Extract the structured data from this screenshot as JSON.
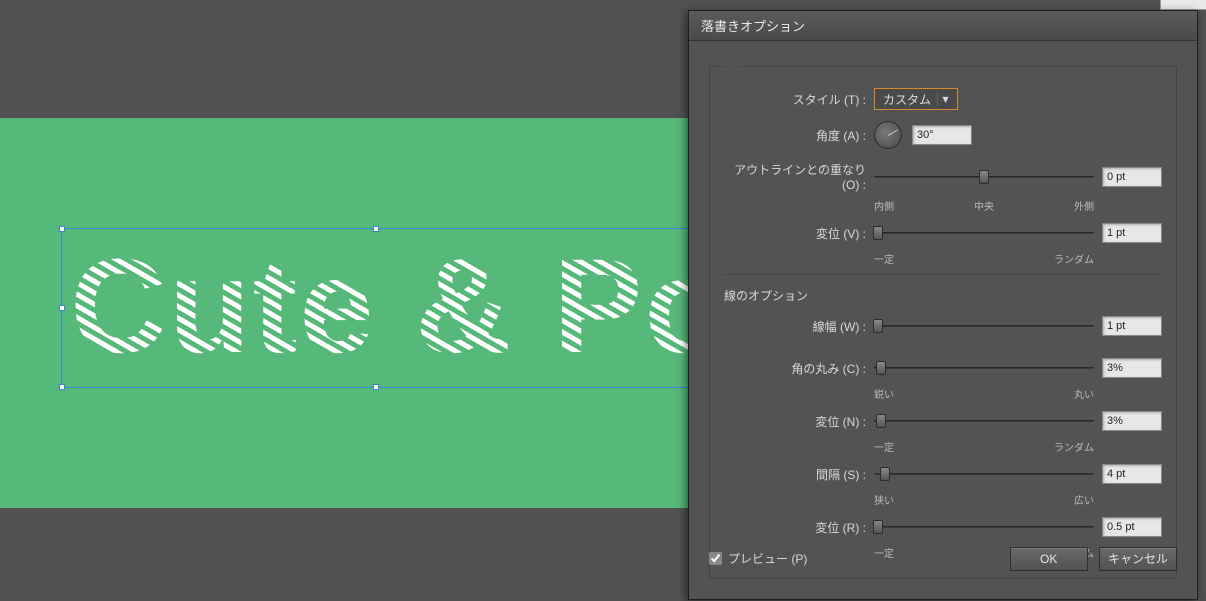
{
  "canvas": {
    "text": "Cute & Po"
  },
  "dialog": {
    "title": "落書きオプション",
    "style": {
      "label": "スタイル (T) :",
      "value": "カスタム"
    },
    "angle": {
      "label": "角度 (A) :",
      "value": "30°"
    },
    "overlap": {
      "label": "アウトラインとの重なり (O) :",
      "value": "0 pt",
      "tick_left": "内側",
      "tick_center": "中央",
      "tick_right": "外側"
    },
    "overlap_var": {
      "label": "変位 (V) :",
      "value": "1 pt",
      "tick_left": "一定",
      "tick_right": "ランダム"
    },
    "line_section": "線のオプション",
    "width": {
      "label": "線幅 (W) :",
      "value": "1 pt"
    },
    "curve": {
      "label": "角の丸み (C) :",
      "value": "3%",
      "tick_left": "鋭い",
      "tick_right": "丸い"
    },
    "curve_var": {
      "label": "変位 (N) :",
      "value": "3%",
      "tick_left": "一定",
      "tick_right": "ランダム"
    },
    "spacing": {
      "label": "間隔 (S) :",
      "value": "4 pt",
      "tick_left": "狭い",
      "tick_right": "広い"
    },
    "spacing_var": {
      "label": "変位 (R) :",
      "value": "0.5 pt",
      "tick_left": "一定",
      "tick_right": "ランダム"
    },
    "preview_label": "プレビュー (P)",
    "ok": "OK",
    "cancel": "キャンセル"
  }
}
